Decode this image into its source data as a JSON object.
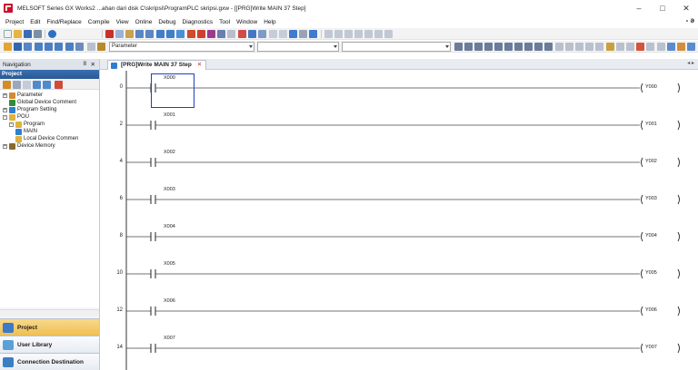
{
  "window": {
    "title": "MELSOFT Series GX Works2 ...ahan dari disk C\\skripsi\\ProgramPLC skripsi.gxw - [[PRG]Write MAIN 37 Step]",
    "minimize": "–",
    "maximize": "□",
    "close": "✕",
    "mdi_close": "- ə"
  },
  "menu": [
    "Project",
    "Edit",
    "Find/Replace",
    "Compile",
    "View",
    "Online",
    "Debug",
    "Diagnostics",
    "Tool",
    "Window",
    "Help"
  ],
  "toolbar": {
    "combo_parameter": "Parameter"
  },
  "navigation": {
    "header": "Navigation",
    "pin": "ȣ",
    "close": "✕",
    "section": "Project",
    "tree": [
      {
        "label": "Parameter",
        "level": 0,
        "expander": "+",
        "icon": "#d18b2c"
      },
      {
        "label": "Global Device Comment",
        "level": 1,
        "expander": "",
        "icon": "#2d8f3a"
      },
      {
        "label": "Program Setting",
        "level": 0,
        "expander": "+",
        "icon": "#2f7fd0"
      },
      {
        "label": "POU",
        "level": 0,
        "expander": "-",
        "icon": "#e0b23a"
      },
      {
        "label": "Program",
        "level": 1,
        "expander": "-",
        "icon": "#e0b23a"
      },
      {
        "label": "MAIN",
        "level": 2,
        "expander": "",
        "icon": "#2f7fd0"
      },
      {
        "label": "Local Device Commen",
        "level": 2,
        "expander": "",
        "icon": "#e0b23a"
      },
      {
        "label": "Device Memory",
        "level": 0,
        "expander": "+",
        "icon": "#8a6a2a"
      }
    ],
    "buttons": [
      {
        "label": "Project",
        "active": true,
        "icon": "#3c79c8"
      },
      {
        "label": "User Library",
        "active": false,
        "icon": "#5aa0d8"
      },
      {
        "label": "Connection Destination",
        "active": false,
        "icon": "#3a7fc2"
      }
    ]
  },
  "editor": {
    "tab_label": "[PRG]Write MAIN 37 Step",
    "tab_close": "✕",
    "tab_scroll": "◂ ▸",
    "rungs": [
      {
        "step": "0",
        "contact": "X000",
        "coil": "Y000"
      },
      {
        "step": "2",
        "contact": "X001",
        "coil": "Y001"
      },
      {
        "step": "4",
        "contact": "X002",
        "coil": "Y002"
      },
      {
        "step": "6",
        "contact": "X003",
        "coil": "Y003"
      },
      {
        "step": "8",
        "contact": "X004",
        "coil": "Y004"
      },
      {
        "step": "10",
        "contact": "X005",
        "coil": "Y005"
      },
      {
        "step": "12",
        "contact": "X006",
        "coil": "Y006"
      },
      {
        "step": "14",
        "contact": "X007",
        "coil": "Y007"
      }
    ]
  }
}
